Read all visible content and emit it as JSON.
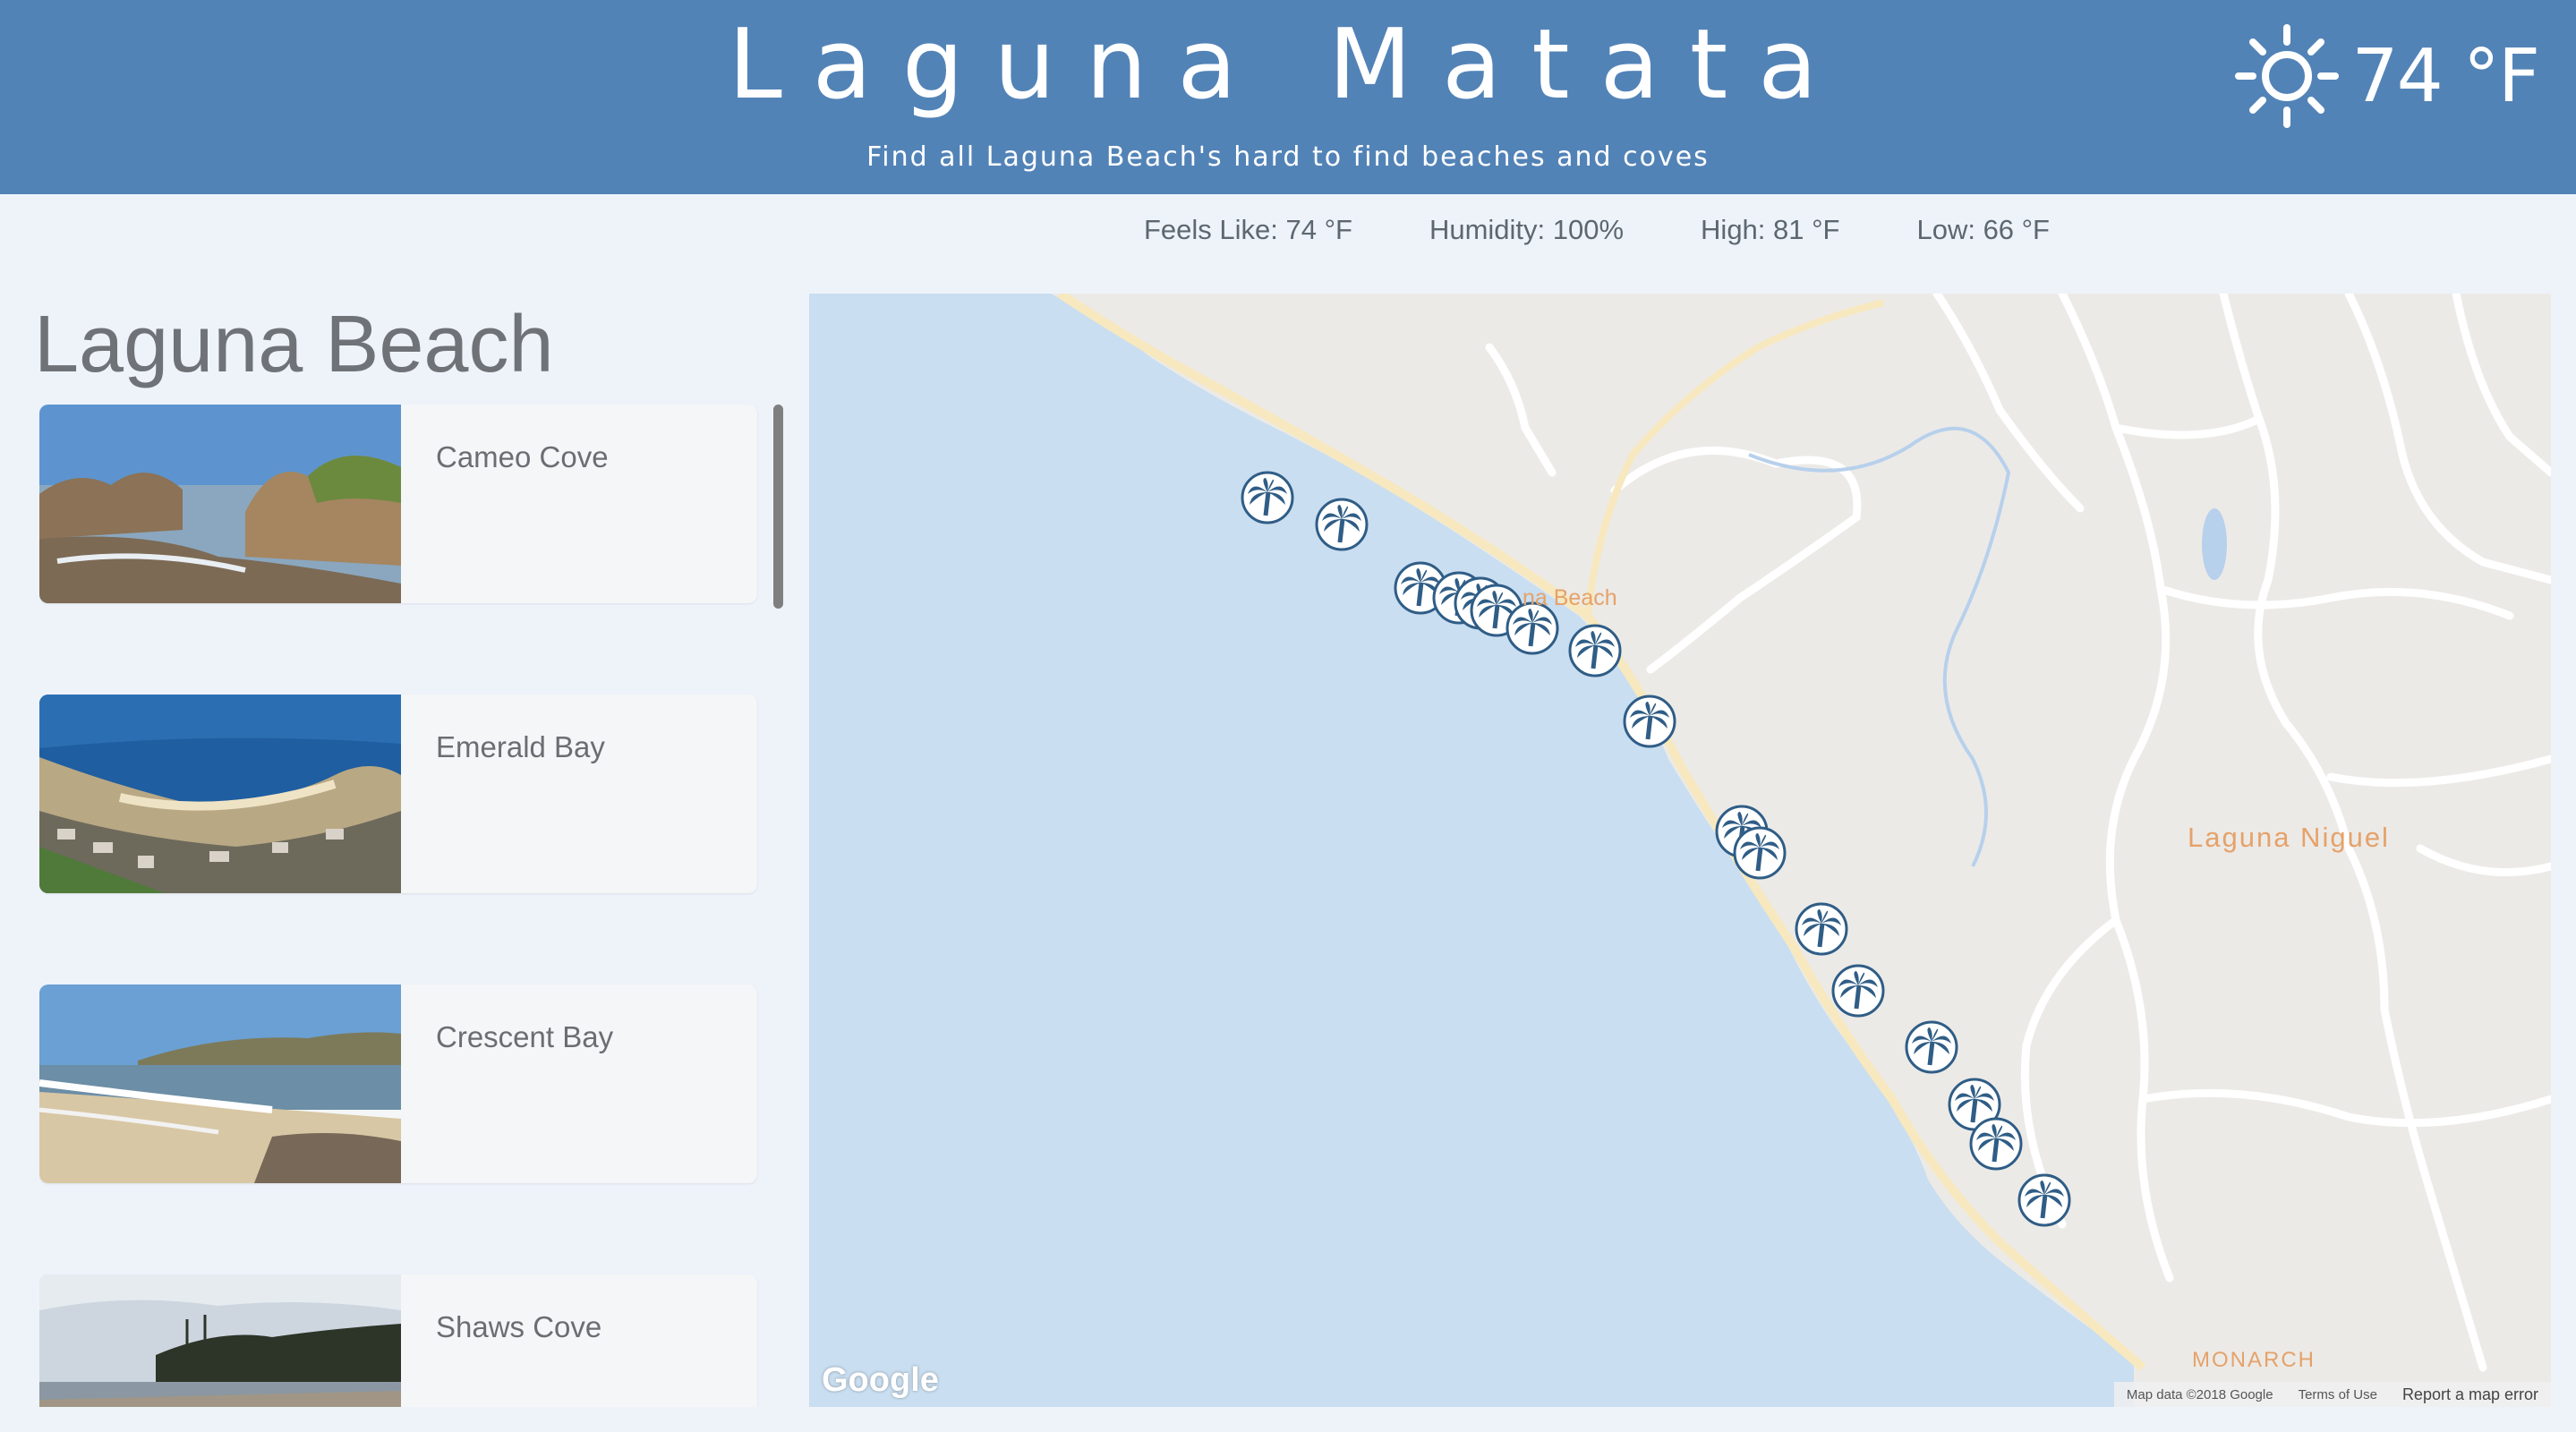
{
  "header": {
    "title": "Laguna Matata",
    "subtitle": "Find all Laguna Beach's hard to find beaches and coves",
    "weather_icon": "sun-icon",
    "temperature": "74 °F"
  },
  "details": {
    "feels_like": "Feels Like: 74 °F",
    "humidity": "Humidity: 100%",
    "high": "High: 81 °F",
    "low": "Low: 66 °F"
  },
  "sidebar": {
    "title": "Laguna Beach",
    "beaches": [
      {
        "name": "Cameo Cove"
      },
      {
        "name": "Emerald Bay"
      },
      {
        "name": "Crescent Bay"
      },
      {
        "name": "Shaws Cove"
      }
    ]
  },
  "map": {
    "labels": {
      "city_partial": "na Beach",
      "niguel": "Laguna Niguel",
      "monarch": "MONARCH"
    },
    "logo": "Google",
    "footer": {
      "data": "Map data ©2018 Google",
      "terms": "Terms of Use",
      "report": "Report a map error"
    },
    "marker_icon": "palm-tree-icon",
    "colors": {
      "water": "#c9def0",
      "land": "#eceae7",
      "marker": "#2f5d86",
      "header": "#5283b7"
    }
  }
}
